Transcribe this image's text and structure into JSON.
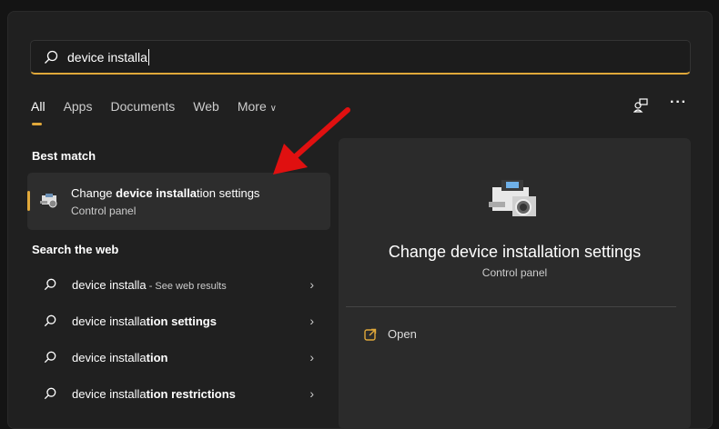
{
  "search": {
    "value": "device installa"
  },
  "tabs": [
    {
      "label": "All"
    },
    {
      "label": "Apps"
    },
    {
      "label": "Documents"
    },
    {
      "label": "Web"
    },
    {
      "label": "More"
    }
  ],
  "best_match": {
    "header": "Best match",
    "title_parts": [
      "Change ",
      "device installa",
      "tion settings"
    ],
    "subtitle": "Control panel"
  },
  "web": {
    "header": "Search the web",
    "items": [
      {
        "normal": "device installa",
        "bold": "",
        "suffix": " - See web results"
      },
      {
        "normal": "device installa",
        "bold": "tion settings",
        "suffix": ""
      },
      {
        "normal": "device installa",
        "bold": "tion",
        "suffix": ""
      },
      {
        "normal": "device installa",
        "bold": "tion restrictions",
        "suffix": ""
      }
    ]
  },
  "preview": {
    "title": "Change device installation settings",
    "subtitle": "Control panel",
    "action": "Open"
  },
  "colors": {
    "accent": "#e0a83a",
    "annotation_arrow": "#e01010"
  }
}
